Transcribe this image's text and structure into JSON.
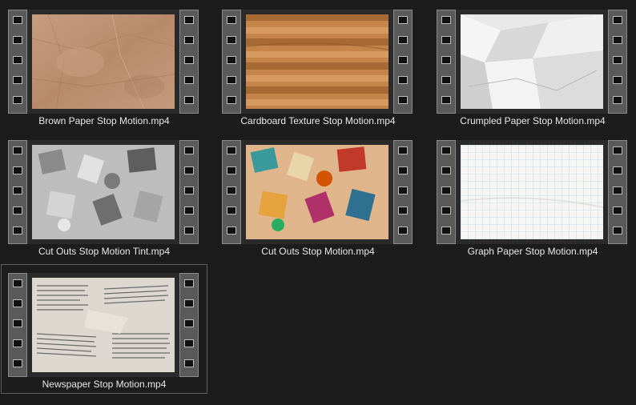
{
  "files": [
    {
      "name": "Brown Paper Stop Motion.mp4",
      "thumbnail": "brown-paper-texture",
      "selected": false
    },
    {
      "name": "Cardboard Texture Stop Motion.mp4",
      "thumbnail": "cardboard-texture",
      "selected": false
    },
    {
      "name": "Crumpled Paper Stop Motion.mp4",
      "thumbnail": "crumpled-paper-texture",
      "selected": false
    },
    {
      "name": "Cut Outs Stop Motion Tint.mp4",
      "thumbnail": "cut-outs-tint-texture",
      "selected": false
    },
    {
      "name": "Cut Outs Stop Motion.mp4",
      "thumbnail": "cut-outs-color-texture",
      "selected": false
    },
    {
      "name": "Graph Paper Stop Motion.mp4",
      "thumbnail": "graph-paper-texture",
      "selected": false
    },
    {
      "name": "Newspaper Stop Motion.mp4",
      "thumbnail": "newspaper-texture",
      "selected": true
    }
  ],
  "colors": {
    "background": "#1c1c1c",
    "film_sprocket": "#5a5a5a",
    "caption_text": "#e8e8e8",
    "selection_border": "#5e5e5e"
  }
}
